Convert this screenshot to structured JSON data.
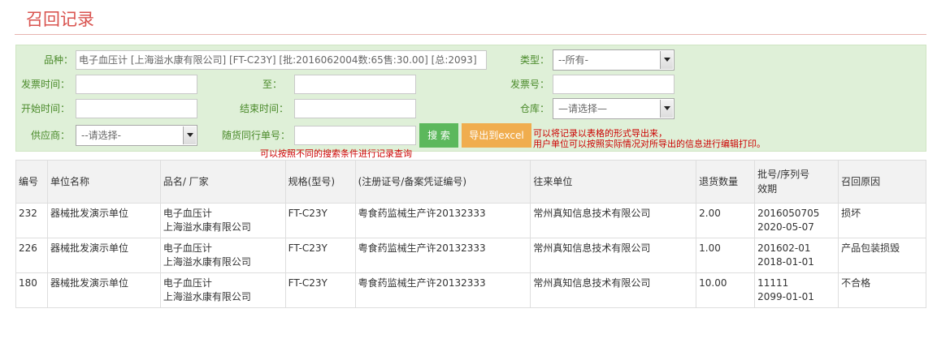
{
  "page_title": "召回记录",
  "filters": {
    "product": {
      "label": "品种：",
      "value": "电子血压计 [上海溢水康有限公司] [FT-C23Y] [批:2016062004数:65售:30.00] [总:2093]"
    },
    "type": {
      "label": "类型：",
      "value": "--所有-"
    },
    "invoice_time": {
      "label": "发票时间：",
      "value": ""
    },
    "to": {
      "label": "至：",
      "value": ""
    },
    "invoice_no": {
      "label": "发票号：",
      "value": ""
    },
    "start_time": {
      "label": "开始时间：",
      "value": ""
    },
    "end_time": {
      "label": "结束时间：",
      "value": ""
    },
    "warehouse": {
      "label": "仓库：",
      "value": "—请选择—"
    },
    "supplier": {
      "label": "供应商：",
      "value": "--请选择-"
    },
    "waybill": {
      "label": "随货同行单号：",
      "value": ""
    },
    "search_label": "搜 索",
    "export_label": "导出到excel"
  },
  "notes": {
    "search_hint": "可以按照不同的搜索条件进行记录查询",
    "export_hint_1": "可以将记录以表格的形式导出来，",
    "export_hint_2": "用户单位可以按照实际情况对所导出的信息进行编辑打印。"
  },
  "table": {
    "headers": {
      "id": "编号",
      "unit": "单位名称",
      "product": "品名/ 厂家",
      "spec": "规格(型号)",
      "license": "(注册证号/备案凭证编号)",
      "partner": "往来单位",
      "qty": "退货数量",
      "batch_1": "批号/序列号",
      "batch_2": "效期",
      "reason": "召回原因"
    },
    "rows": [
      {
        "id": "232",
        "unit": "器械批发演示单位",
        "product_1": "电子血压计",
        "product_2": "上海溢水康有限公司",
        "spec": "FT-C23Y",
        "license": "粤食药监械生产许20132333",
        "partner": "常州真知信息技术有限公司",
        "qty": "2.00",
        "batch": "2016050705",
        "expiry": "2020-05-07",
        "reason": "损坏"
      },
      {
        "id": "226",
        "unit": "器械批发演示单位",
        "product_1": "电子血压计",
        "product_2": "上海溢水康有限公司",
        "spec": "FT-C23Y",
        "license": "粤食药监械生产许20132333",
        "partner": "常州真知信息技术有限公司",
        "qty": "1.00",
        "batch": "201602-01",
        "expiry": "2018-01-01",
        "reason": "产品包装损毁"
      },
      {
        "id": "180",
        "unit": "器械批发演示单位",
        "product_1": "电子血压计",
        "product_2": "上海溢水康有限公司",
        "spec": "FT-C23Y",
        "license": "粤食药监械生产许20132333",
        "partner": "常州真知信息技术有限公司",
        "qty": "10.00",
        "batch": "11111",
        "expiry": "2099-01-01",
        "reason": "不合格"
      }
    ]
  }
}
